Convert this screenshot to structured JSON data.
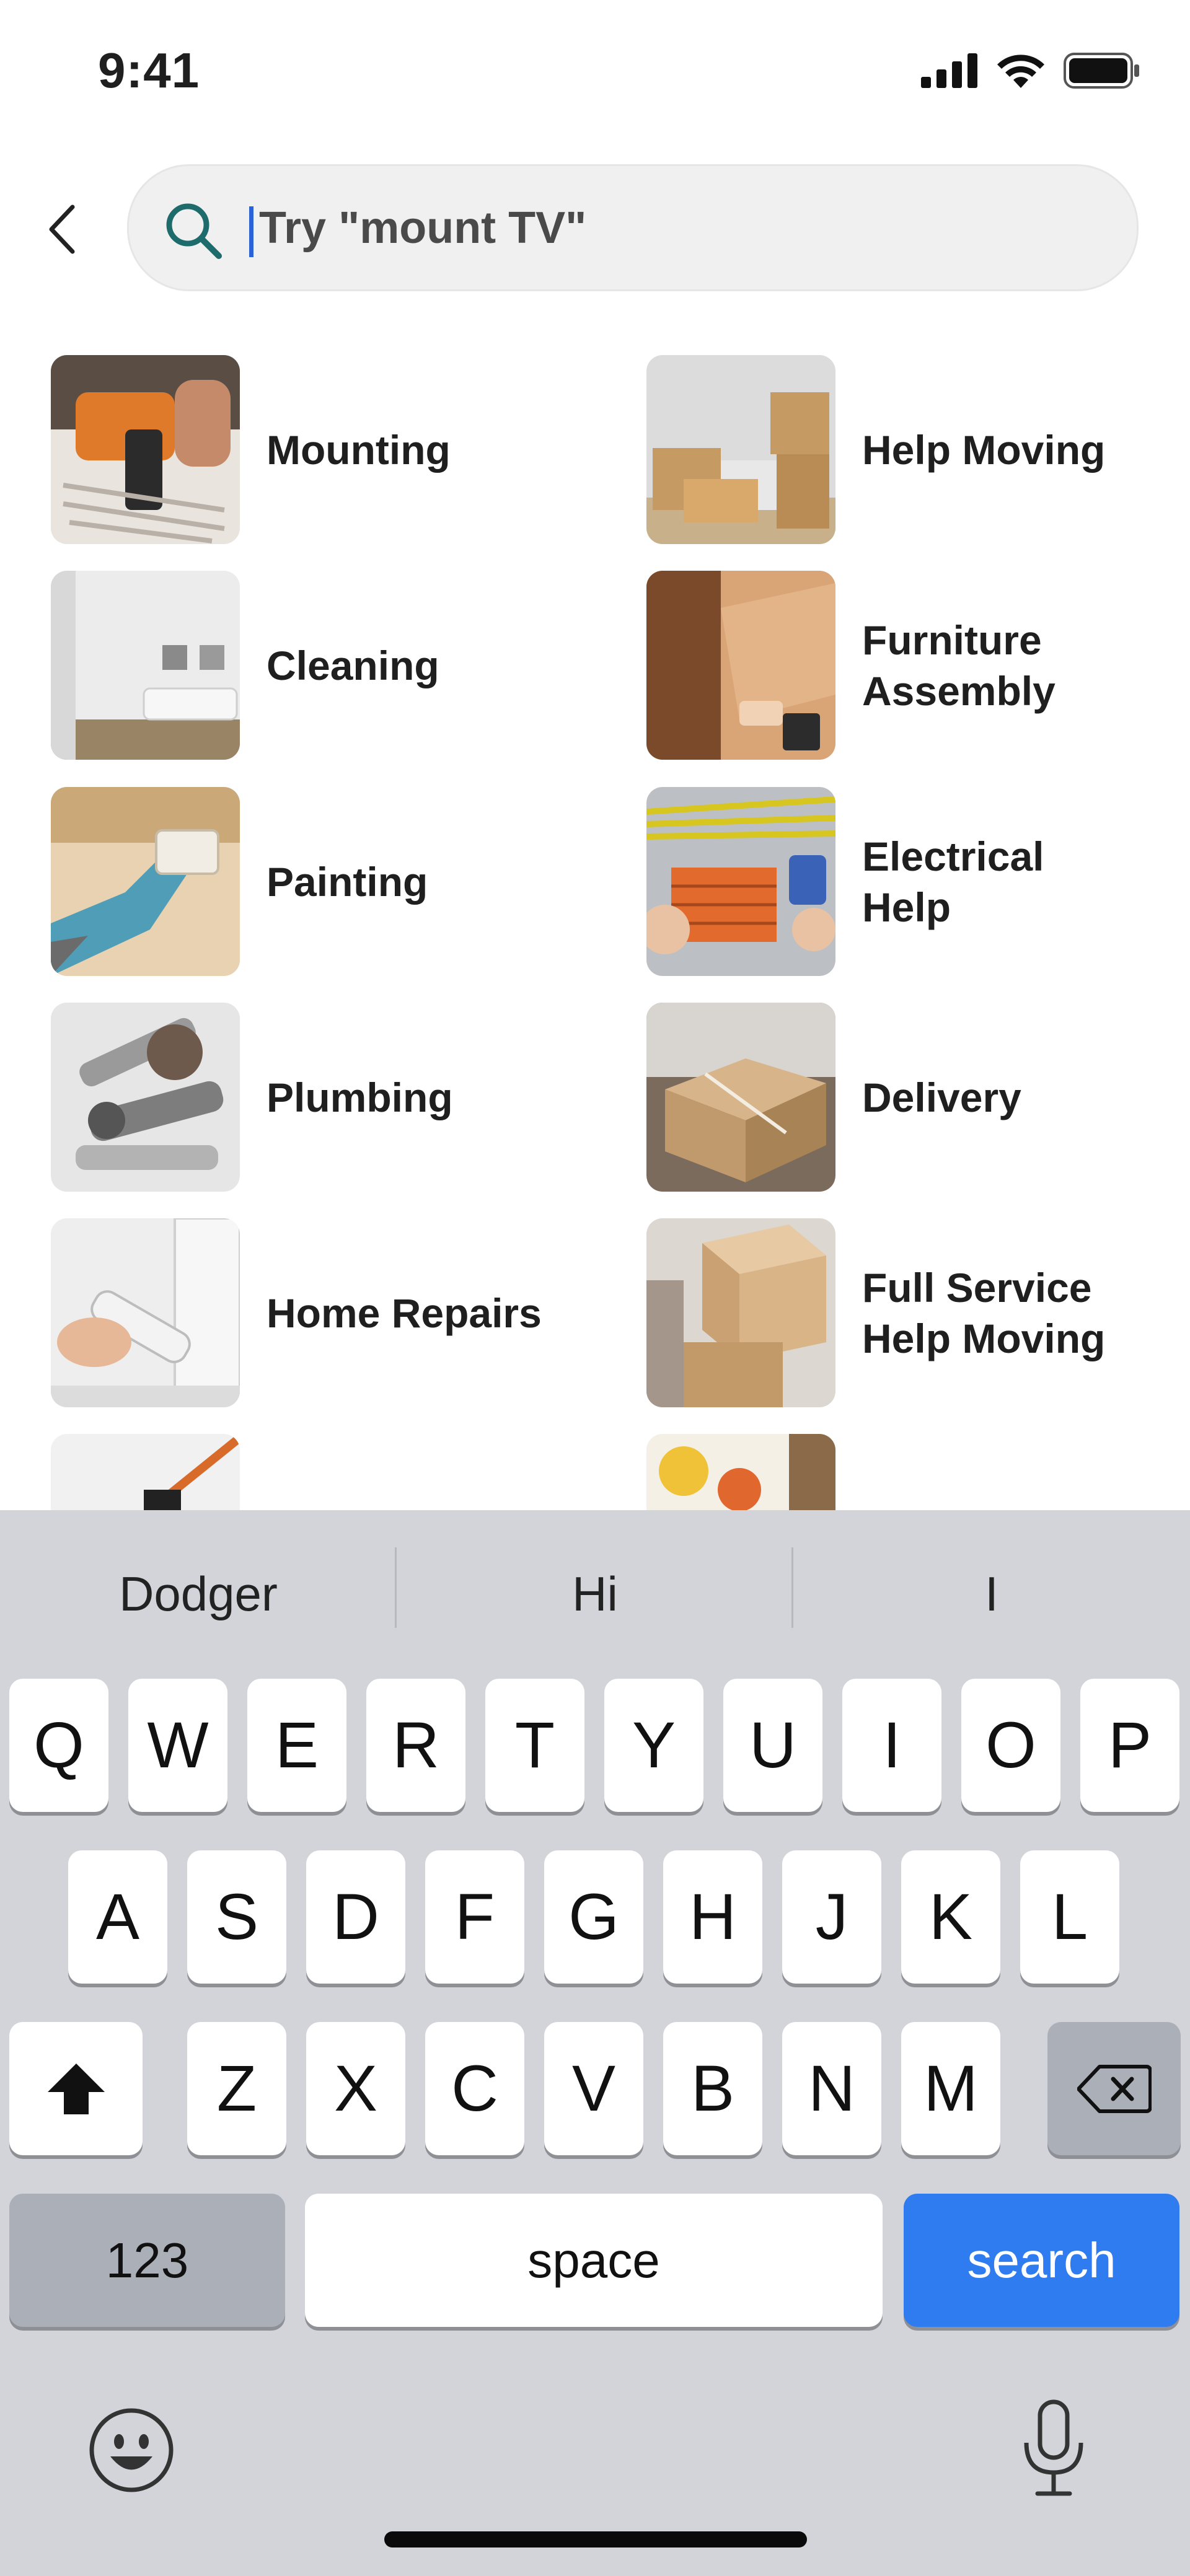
{
  "status_bar": {
    "time": "9:41",
    "icons": [
      "signal-icon",
      "wifi-icon",
      "battery-icon"
    ]
  },
  "search": {
    "placeholder": "Try \"mount TV\"",
    "value": ""
  },
  "categories": [
    {
      "label": "Mounting"
    },
    {
      "label": "Help Moving"
    },
    {
      "label": "Cleaning"
    },
    {
      "label": "Furniture\nAssembly"
    },
    {
      "label": "Painting"
    },
    {
      "label": "Electrical\nHelp"
    },
    {
      "label": "Plumbing"
    },
    {
      "label": "Delivery"
    },
    {
      "label": "Home Repairs"
    },
    {
      "label": "Full Service\nHelp Moving"
    }
  ],
  "keyboard": {
    "suggestions": [
      "Dodger",
      "Hi",
      "I"
    ],
    "row1": [
      "Q",
      "W",
      "E",
      "R",
      "T",
      "Y",
      "U",
      "I",
      "O",
      "P"
    ],
    "row2": [
      "A",
      "S",
      "D",
      "F",
      "G",
      "H",
      "J",
      "K",
      "L"
    ],
    "row3": [
      "Z",
      "X",
      "C",
      "V",
      "B",
      "N",
      "M"
    ],
    "numbers_key": "123",
    "space_key": "space",
    "search_key": "search"
  },
  "colors": {
    "accent": "#2f7bf0",
    "keyboard_bg": "#d2d4da",
    "search_icon": "#1d6b6a"
  }
}
